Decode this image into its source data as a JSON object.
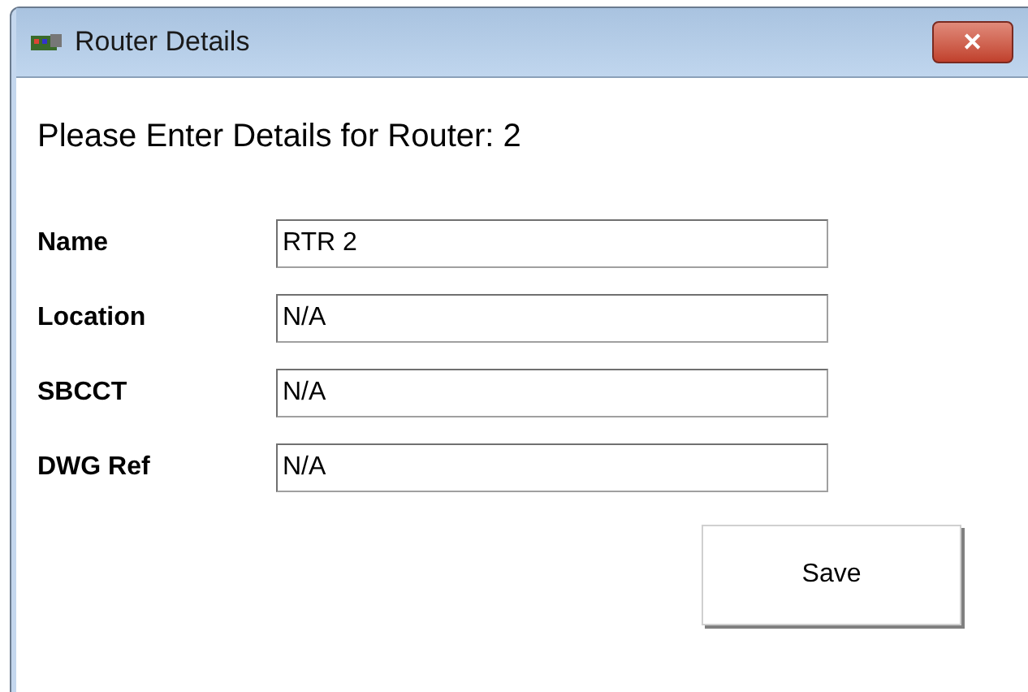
{
  "window": {
    "title": "Router Details",
    "close": "✕"
  },
  "heading": "Please Enter Details for Router: 2",
  "fields": [
    {
      "label": "Name",
      "value": "RTR 2"
    },
    {
      "label": "Location",
      "value": "N/A"
    },
    {
      "label": "SBCCT",
      "value": "N/A"
    },
    {
      "label": "DWG Ref",
      "value": "N/A"
    }
  ],
  "buttons": [
    "Save"
  ]
}
